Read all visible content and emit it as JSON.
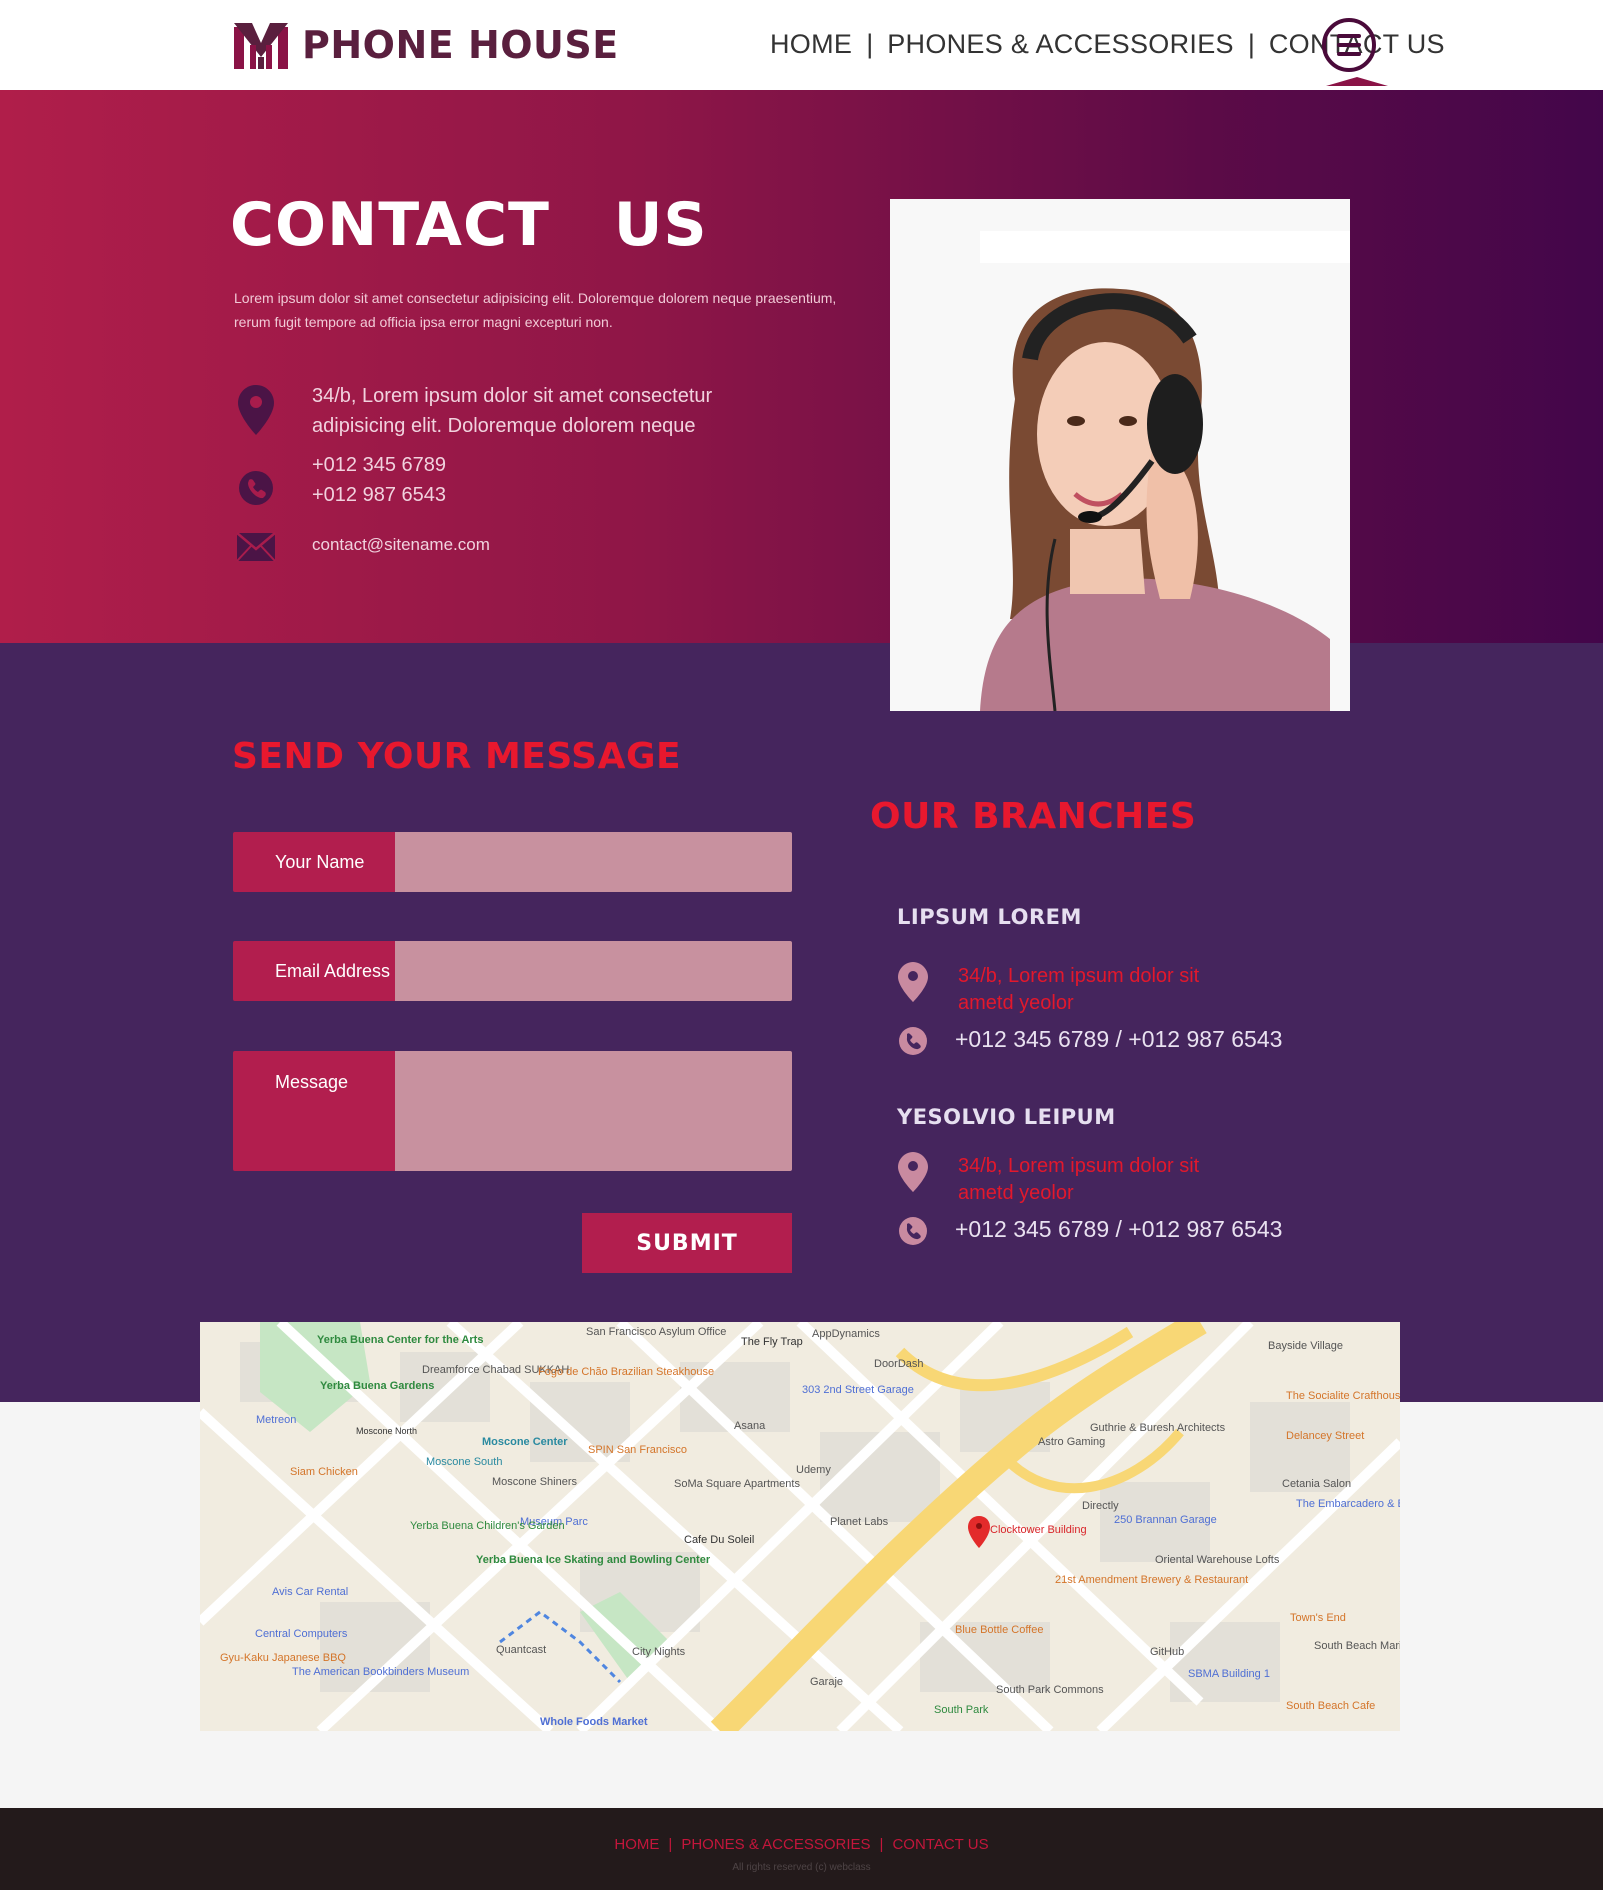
{
  "header": {
    "brand": "PHONE HOUSE",
    "nav": [
      "HOME",
      "PHONES & ACCESSORIES",
      "CONTACT US"
    ],
    "active_nav": "CONTACT US"
  },
  "hero": {
    "title": "CONTACT  US",
    "description": "Lorem ipsum dolor sit amet consectetur adipisicing elit. Doloremque dolorem neque praesentium, rerum fugit tempore ad officia ipsa error magni excepturi non.",
    "address_line1": "34/b, Lorem ipsum dolor sit amet consectetur",
    "address_line2": "adipisicing elit. Doloremque dolorem neque",
    "phone1": "+012 345 6789",
    "phone2": "+012 987 6543",
    "email": "contact@sitename.com"
  },
  "form": {
    "title": "SEND YOUR MESSAGE",
    "name_label": "Your Name",
    "email_label": "Email Address",
    "message_label": "Message",
    "submit_label": "SUBMIT"
  },
  "branches": {
    "title": "OUR BRANCHES",
    "items": [
      {
        "name": "LIPSUM LOREM",
        "address_line1": "34/b, Lorem ipsum dolor sit",
        "address_line2": "ametd yeolor",
        "phones": "+012 345 6789 / +012 987 6543"
      },
      {
        "name": "YESOLVIO LEIPUM",
        "address_line1": "34/b, Lorem ipsum dolor sit",
        "address_line2": "ametd yeolor",
        "phones": "+012 345 6789 / +012 987 6543"
      }
    ]
  },
  "map": {
    "labels": {
      "yerba_center": "Yerba Buena Center for the Arts",
      "yerba_gardens": "Yerba Buena Gardens",
      "dreamforce": "Dreamforce Chabad SUKKAH",
      "fogo": "Fogo de Chão Brazilian Steakhouse",
      "sf_asylum": "San Francisco Asylum Office",
      "fly_trap": "The Fly Trap",
      "appdynamics": "AppDynamics",
      "doordash": "DoorDash",
      "garage_303": "303 2nd Street Garage",
      "bayside": "Bayside Village",
      "socialite": "The Socialite Crafthouse & Kitchen",
      "metreon": "Metreon",
      "moscone_north": "Moscone North",
      "moscone_center": "Moscone Center",
      "spin": "SPIN San Francisco",
      "asana": "Asana",
      "udemy": "Udemy",
      "astro": "Astro Gaming",
      "guthrie": "Guthrie & Buresh Architects",
      "delancey": "Delancey Street",
      "siam": "Siam Chicken",
      "moscone_south": "Moscone South",
      "moscone_shiners": "Moscone Shiners",
      "soma": "SoMa Square Apartments",
      "directly": "Directly",
      "brannan_garage": "250 Brannan Garage",
      "cetania": "Cetania Salon",
      "embarcadero": "The Embarcadero & Brannan St",
      "museum_parc": "Museum Parc",
      "planet_labs": "Planet Labs",
      "clocktower": "Clocktower Building",
      "childrens_garden": "Yerba Buena Children's Garden",
      "cafe": "Cafe Du Soleil",
      "orientwarehouse": "Oriental Warehouse Lofts",
      "ice_skating": "Yerba Buena Ice Skating and Bowling Center",
      "amendment": "21st Amendment Brewery & Restaurant",
      "avis": "Avis Car Rental",
      "central": "Central Computers",
      "blue_bottle": "Blue Bottle Coffee",
      "towns_end": "Town's End",
      "gyu_kaku": "Gyu-Kaku Japanese BBQ",
      "quantcast": "Quantcast",
      "city_nights": "City Nights",
      "github": "GitHub",
      "south_beach": "South Beach Marina Apartment",
      "american_bookbinders": "The American Bookbinders Museum",
      "whole_foods": "Whole Foods Market",
      "garaje": "Garaje",
      "south_park_commons": "South Park Commons",
      "sbma": "SBMA Building 1",
      "south_park": "South Park",
      "south_beach_cafe": "South Beach Cafe"
    }
  },
  "footer": {
    "nav": [
      "HOME",
      "PHONES & ACCESSORIES",
      "CONTACT US"
    ],
    "copyright": "All rights reserved (c) webclass"
  }
}
